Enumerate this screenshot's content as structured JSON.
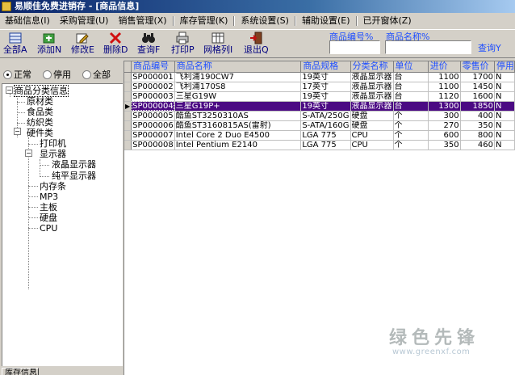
{
  "window": {
    "title": "易顺佳免费进销存 - [商品信息]"
  },
  "menu": [
    "基础信息(I)",
    "采购管理(U)",
    "销售管理(X)",
    "库存管理(K)",
    "系统设置(S)",
    "辅助设置(E)",
    "已开窗体(Z)"
  ],
  "toolbar": {
    "all_label": "全部A",
    "add_label": "添加N",
    "edit_label": "修改E",
    "delete_label": "删除D",
    "query_label": "查询F",
    "print_label": "打印P",
    "grid_label": "网格列I",
    "exit_label": "退出Q"
  },
  "search": {
    "code_label": "商品编号%",
    "name_label": "商品名称%",
    "code_value": "",
    "name_value": "",
    "button_label": "查询Y"
  },
  "filter": {
    "options": [
      "正常",
      "停用",
      "全部"
    ],
    "selected": "正常"
  },
  "tree": {
    "root": "商品分类信息",
    "nodes": {
      "raw": "原材类",
      "food": "食品类",
      "textile": "纺织类",
      "hardware": "硬件类",
      "printer": "打印机",
      "display": "显示器",
      "lcd": "液晶显示器",
      "crt": "纯平显示器",
      "memory": "内存条",
      "mp3": "MP3",
      "board": "主板",
      "disk": "硬盘",
      "cpu": "CPU"
    }
  },
  "bottom_tab": "库存信息",
  "table": {
    "columns": [
      "商品编号",
      "商品名称",
      "商品规格",
      "分类名称",
      "单位",
      "进价",
      "零售价",
      "停用"
    ],
    "rows": [
      [
        "SP000001",
        "飞利浦190CW7",
        "19英寸",
        "液晶显示器",
        "台",
        "1100",
        "1700",
        "N"
      ],
      [
        "SP000002",
        "飞利浦170S8",
        "17英寸",
        "液晶显示器",
        "台",
        "1100",
        "1450",
        "N"
      ],
      [
        "SP000003",
        "三星G19W",
        "19英寸",
        "液晶显示器",
        "台",
        "1120",
        "1600",
        "N"
      ],
      [
        "SP000004",
        "三星G19P+",
        "19英寸",
        "液晶显示器",
        "台",
        "1300",
        "1850",
        "N"
      ],
      [
        "SP000005",
        "酷鱼ST3250310AS",
        "S-ATA/250G",
        "硬盘",
        "个",
        "300",
        "400",
        "N"
      ],
      [
        "SP000006",
        "酷鱼ST3160815AS(雷射)",
        "S-ATA/160G",
        "硬盘",
        "个",
        "270",
        "350",
        "N"
      ],
      [
        "SP000007",
        "Intel Core 2 Duo E4500",
        "LGA 775",
        "CPU",
        "个",
        "600",
        "800",
        "N"
      ],
      [
        "SP000008",
        "Intel Pentium E2140",
        "LGA 775",
        "CPU",
        "个",
        "350",
        "460",
        "N"
      ]
    ],
    "selected_row": 3
  },
  "watermark": {
    "text": "绿色先锋",
    "url": "www.greenxf.com"
  },
  "colors": {
    "selection": "#4b0a83",
    "accent_text": "#1f4fff",
    "title_bar": "#0a246a"
  }
}
